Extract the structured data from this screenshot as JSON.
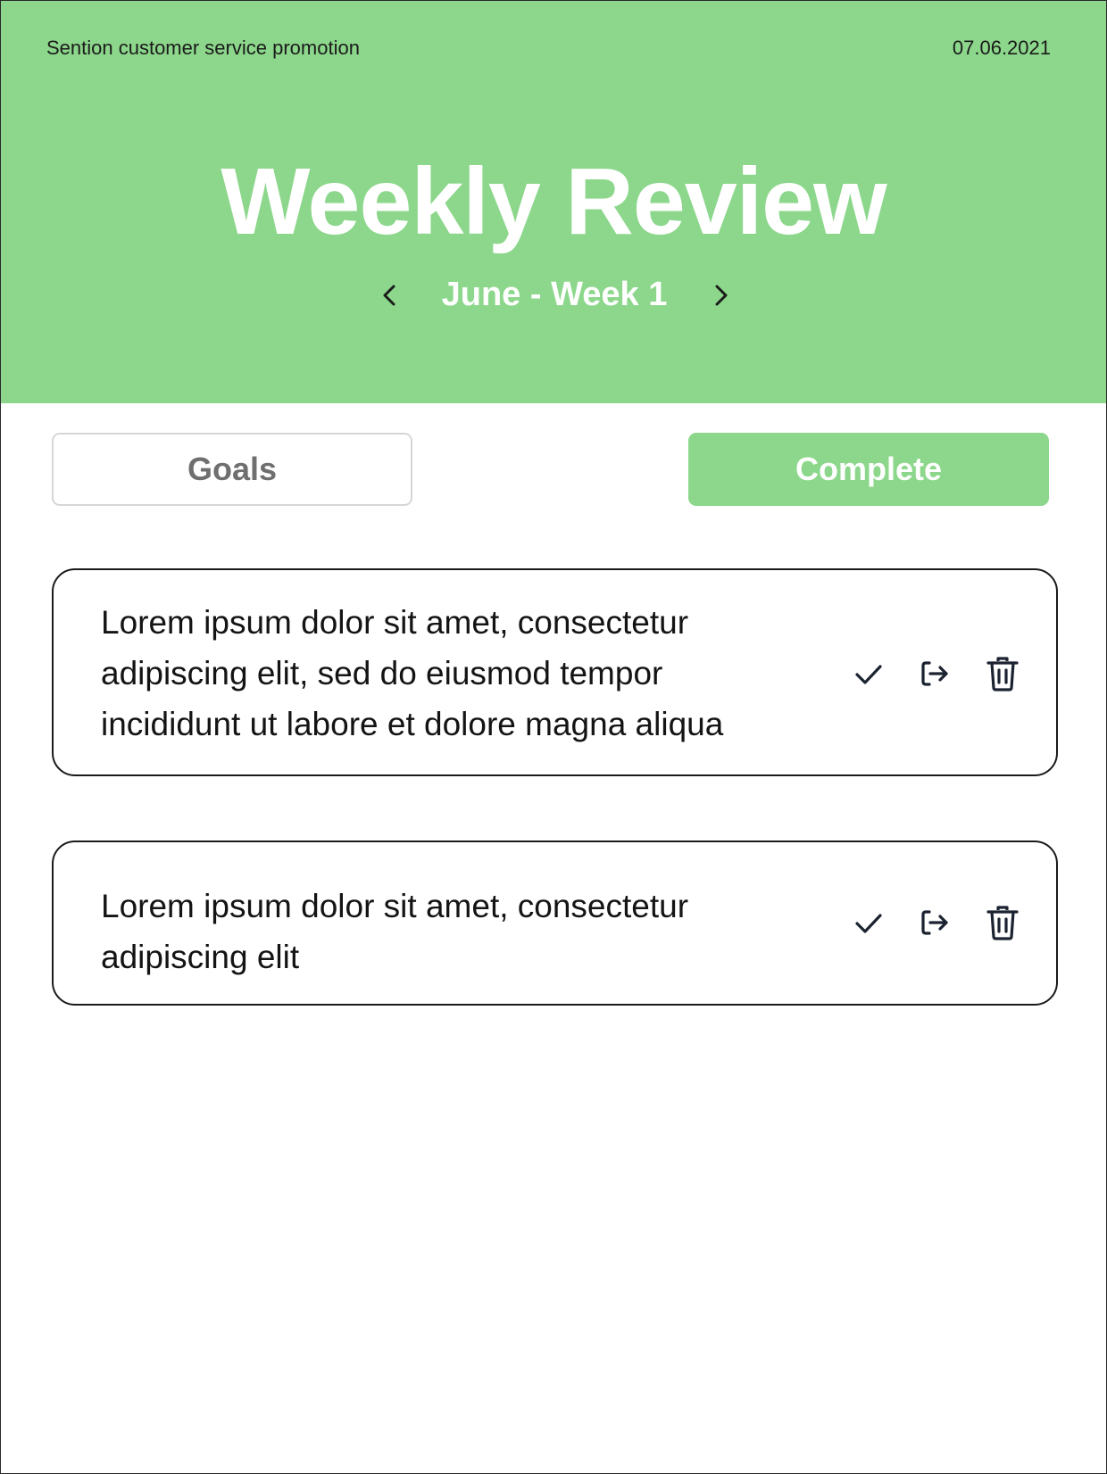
{
  "header": {
    "app_name": "Sention customer service promotion",
    "date": "07.06.2021",
    "title": "Weekly Review",
    "week_label": "June - Week 1",
    "prev_icon": "chevron-left-icon",
    "next_icon": "chevron-right-icon"
  },
  "tabs": [
    {
      "label": "Goals",
      "active": false
    },
    {
      "label": "Complete",
      "active": true
    }
  ],
  "goals": [
    {
      "text": "Lorem ipsum dolor sit amet, consectetur adipiscing elit, sed do eiusmod tempor incididunt ut labore et dolore magna aliqua",
      "actions": [
        "check-icon",
        "move-icon",
        "trash-icon"
      ]
    },
    {
      "text": "Lorem ipsum dolor sit amet, consectetur adipiscing elit",
      "actions": [
        "check-icon",
        "move-icon",
        "trash-icon"
      ]
    }
  ],
  "colors": {
    "accent": "#8cd78b",
    "text": "#141414",
    "inactive_tab_text": "#6f6f6f",
    "inactive_tab_border": "#d6d6d6"
  }
}
